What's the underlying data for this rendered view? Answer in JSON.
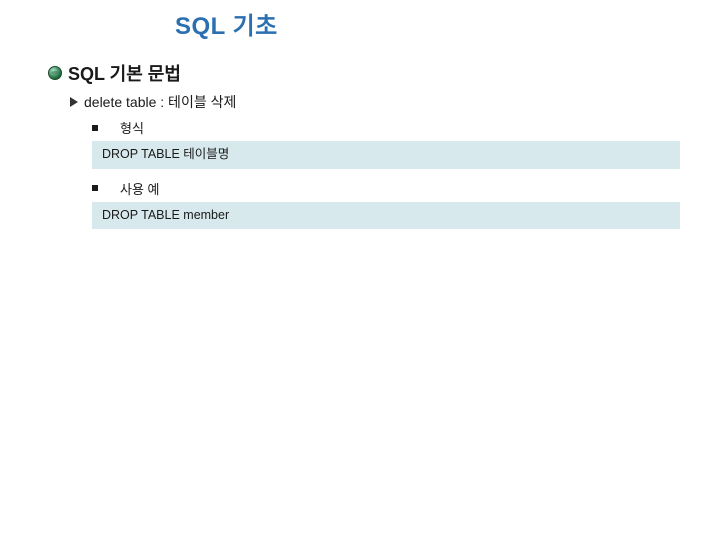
{
  "title": "SQL 기초",
  "section": {
    "heading": "SQL 기본 문법",
    "sub": {
      "heading": "delete table  : 테이블 삭제",
      "items": [
        {
          "label": "형식",
          "code": "DROP TABLE 테이블명"
        },
        {
          "label": "사용 예",
          "code": "DROP TABLE member"
        }
      ]
    }
  }
}
